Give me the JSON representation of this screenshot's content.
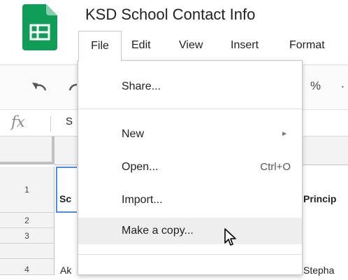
{
  "app": {
    "doc_title": "KSD School Contact Info",
    "logo_color": "#0f9d58"
  },
  "menubar": {
    "items": [
      "File",
      "Edit",
      "View",
      "Insert",
      "Format"
    ]
  },
  "toolbar": {
    "percent_label": "%",
    "more_label": "."
  },
  "formula_bar": {
    "fx_label": "fx",
    "value": "S"
  },
  "grid": {
    "row_numbers": [
      "1",
      "2",
      "3",
      "4"
    ],
    "cells": {
      "a1": "Sc",
      "c1": "Princip",
      "a4": "Ak",
      "c4": "Stepha"
    },
    "active_color": "#4d8af0"
  },
  "file_menu": {
    "share": "Share...",
    "new": "New",
    "open": "Open...",
    "open_shortcut": "Ctrl+O",
    "import": "Import...",
    "make_copy": "Make a copy...",
    "submenu_arrow": "►"
  }
}
